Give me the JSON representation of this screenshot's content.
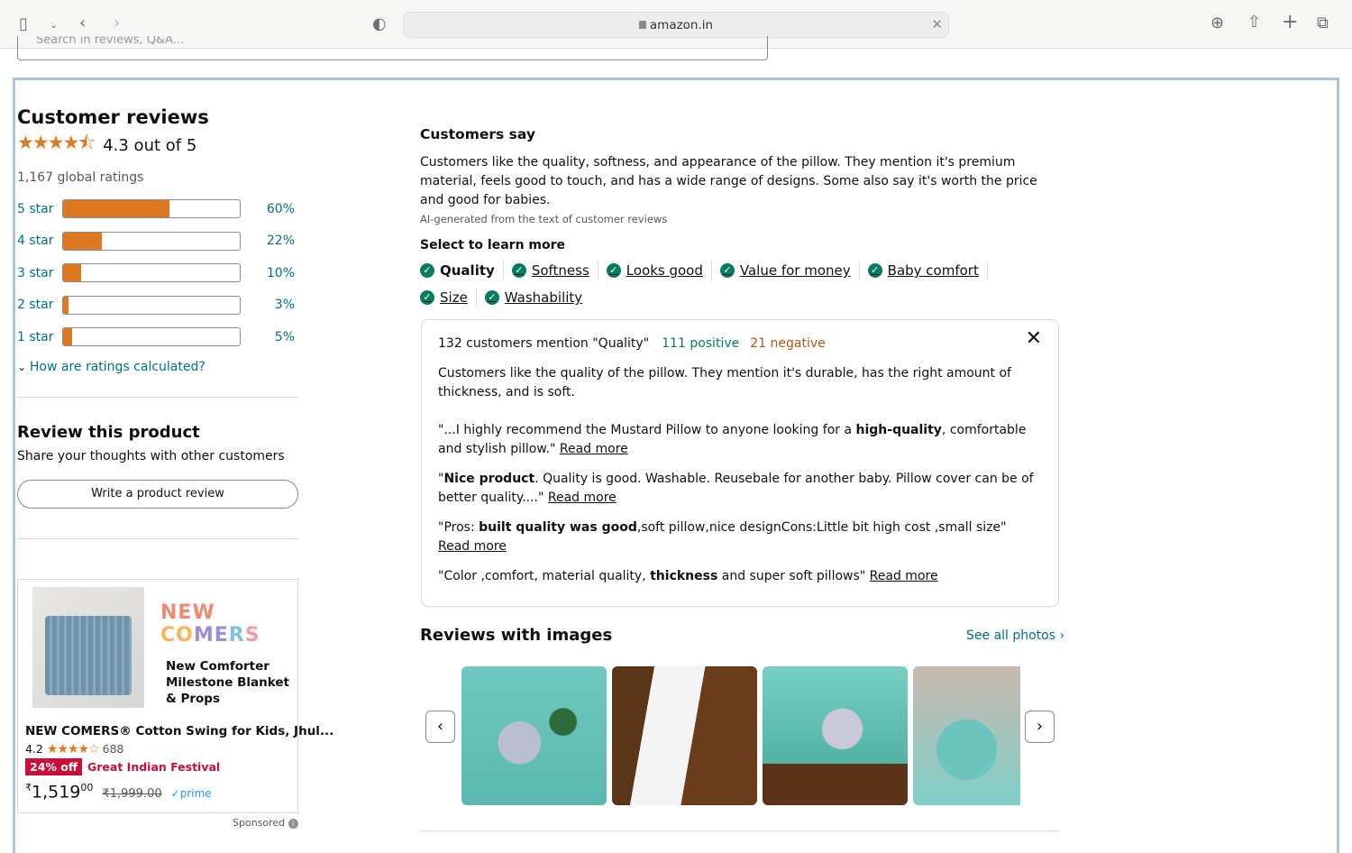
{
  "browser": {
    "url": "amazon.in",
    "icons": [
      "sidebar-icon",
      "chevron-down-icon",
      "back-icon",
      "forward-icon",
      "shield-icon",
      "download-icon",
      "share-icon",
      "new-tab-icon",
      "tabs-icon"
    ]
  },
  "search": {
    "placeholder": "Search in reviews, Q&A..."
  },
  "reviews": {
    "title": "Customer reviews",
    "stars_glyph": "★★★★⯪",
    "rating_text": "4.3 out of 5",
    "rating_value": 4.3,
    "global_ratings": "1,167 global ratings",
    "histogram": [
      {
        "label": "5 star",
        "percent": 60,
        "percent_text": "60%"
      },
      {
        "label": "4 star",
        "percent": 22,
        "percent_text": "22%"
      },
      {
        "label": "3 star",
        "percent": 10,
        "percent_text": "10%"
      },
      {
        "label": "2 star",
        "percent": 3,
        "percent_text": "3%"
      },
      {
        "label": "1 star",
        "percent": 5,
        "percent_text": "5%"
      }
    ],
    "how_calculated": "How are ratings calculated?"
  },
  "review_product": {
    "title": "Review this product",
    "subtitle": "Share your thoughts with other customers",
    "button": "Write a product review"
  },
  "ad": {
    "brand": [
      "NEW",
      " CO",
      "ME",
      "R",
      "S"
    ],
    "headline": "New Comforter Milestone Blanket & Props",
    "product": "NEW COMERS® Cotton Swing for Kids, Jhul...",
    "rating": "4.2",
    "stars_glyph": "★★★★☆",
    "rating_count": "688",
    "discount": "24% off",
    "event": "Great Indian Festival",
    "price_symbol": "₹",
    "price_whole": "1,519",
    "price_fraction": "00",
    "old_price": "₹1,999.00",
    "prime": "✓prime",
    "sponsored": "Sponsored"
  },
  "customers_say": {
    "title": "Customers say",
    "summary": "Customers like the quality, softness, and appearance of the pillow. They mention it's premium material, feels good to touch, and has a wide range of designs. Some also say it's worth the price and good for babies.",
    "ai_note": "AI-generated from the text of customer reviews",
    "select_label": "Select to learn more",
    "aspects": [
      {
        "label": "Quality",
        "active": true
      },
      {
        "label": "Softness",
        "active": false
      },
      {
        "label": "Looks good",
        "active": false
      },
      {
        "label": "Value for money",
        "active": false
      },
      {
        "label": "Baby comfort",
        "active": false
      },
      {
        "label": "Size",
        "active": false
      },
      {
        "label": "Washability",
        "active": false
      }
    ]
  },
  "aspect_panel": {
    "mention": "132 customers mention \"Quality\"",
    "positive": "111 positive",
    "negative": "21 negative",
    "summary": "Customers like the quality of the pillow. They mention it's durable, has the right amount of thickness, and is soft.",
    "read_more": "Read more",
    "quotes": [
      {
        "pre": "\"...I highly recommend the Mustard Pillow to anyone looking for a ",
        "bold": "high-quality",
        "post": ", comfortable and stylish pillow.\" "
      },
      {
        "pre": "\"",
        "bold": "Nice product",
        "post": ". Quality is good. Washable. Reusebale for another baby. Pillow cover can be of better quality....\" "
      },
      {
        "pre": "\"Pros: ",
        "bold": "built quality was good",
        "post": ",soft pillow,nice designCons:Little bit high cost ,small size\" "
      },
      {
        "pre": "\"Color ,comfort, material quality, ",
        "bold": "thickness",
        "post": " and super soft pillows\" "
      }
    ]
  },
  "images_section": {
    "title": "Reviews with images",
    "see_all": "See all photos ›",
    "prev": "‹",
    "next": "›",
    "images": [
      "pillow-elephant-print",
      "white-pillow-held",
      "pillow-elephant-held",
      "child-with-pillow"
    ]
  }
}
